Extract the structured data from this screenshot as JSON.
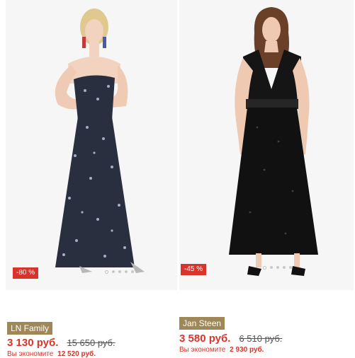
{
  "products": [
    {
      "brand": "LN Family",
      "price": "3 130 руб.",
      "old_price": "15 650 руб.",
      "discount": "-80 %",
      "saving_label": "Вы экономите",
      "saving_value": "12 520 руб.",
      "image": "dark floral strapless maxi dress",
      "colors": {
        "dress": "#2a2f3f",
        "accent": "#9f8757"
      }
    },
    {
      "brand": "Jan Steen",
      "price": "3 580 руб.",
      "old_price": "6 510 руб.",
      "discount": "-45 %",
      "saving_label": "Вы экономите",
      "saving_value": "2 930 руб.",
      "image": "black sequin v-neck maxi dress",
      "colors": {
        "dress": "#111111",
        "accent": "#9f8757"
      }
    }
  ]
}
